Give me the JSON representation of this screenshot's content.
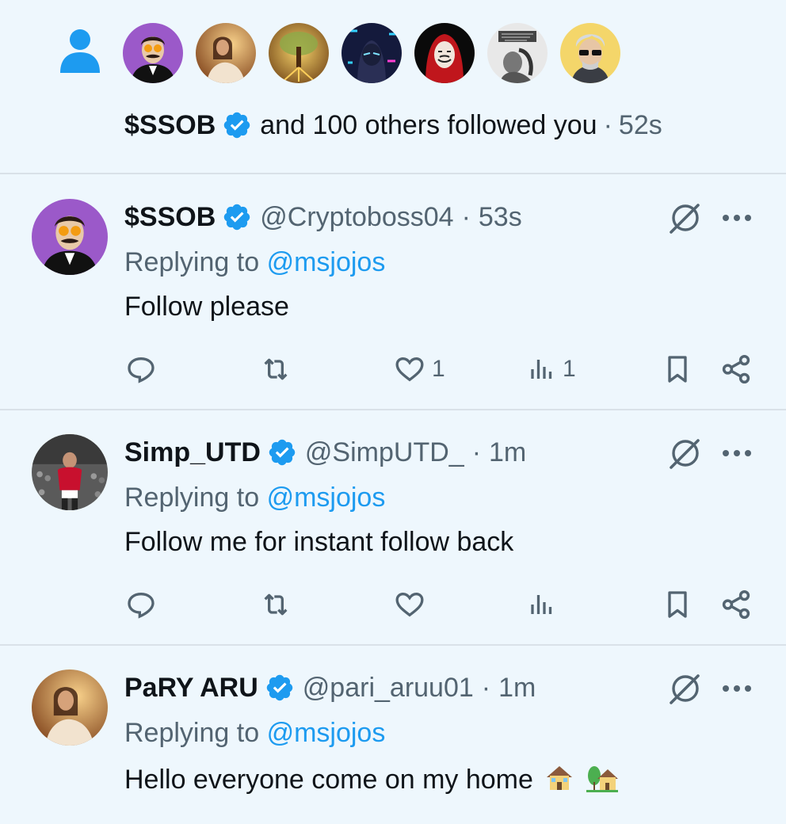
{
  "follow_notification": {
    "name": "$SSOB",
    "text": "and 100 others followed you",
    "separator": "·",
    "time": "52s",
    "avatar_icons": [
      "avatar-mustache-man",
      "avatar-woman-warm",
      "avatar-glowing-tree",
      "avatar-neon-masked",
      "avatar-red-hood-mask",
      "avatar-bw-portrait",
      "avatar-sunglasses-man"
    ]
  },
  "tweets": [
    {
      "name": "$SSOB",
      "handle": "@Cryptoboss04",
      "separator": "·",
      "time": "53s",
      "replying_prefix": "Replying to",
      "replying_to": "@msjojos",
      "text": "Follow please",
      "like_count": "1",
      "view_count": "1"
    },
    {
      "name": "Simp_UTD",
      "handle": "@SimpUTD_",
      "separator": "·",
      "time": "1m",
      "replying_prefix": "Replying to",
      "replying_to": "@msjojos",
      "text": "Follow me for instant follow back",
      "like_count": "",
      "view_count": ""
    },
    {
      "name": "PaRY ARU",
      "handle": "@pari_aruu01",
      "separator": "·",
      "time": "1m",
      "replying_prefix": "Replying to",
      "replying_to": "@msjojos",
      "text": "Hello everyone come on my home",
      "emoji": [
        "house-emoji",
        "house-with-garden-emoji"
      ]
    }
  ],
  "colors": {
    "background": "#eef7fd",
    "accent": "#1d9bf0",
    "muted": "#536471",
    "text": "#0f1419",
    "divider": "#d9e1e8"
  }
}
